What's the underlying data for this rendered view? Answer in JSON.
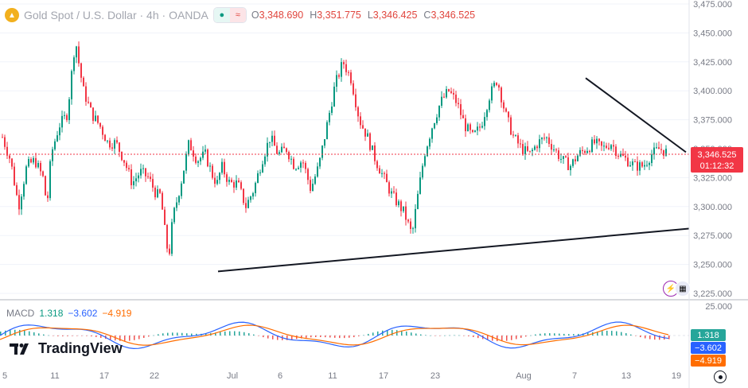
{
  "header": {
    "symbol_title": "Gold Spot / U.S. Dollar · 4h · OANDA",
    "pill_left_glyph": "●",
    "pill_right_glyph": "≈",
    "ohlc": [
      {
        "key": "O",
        "value": "3,348.690"
      },
      {
        "key": "H",
        "value": "3,351.775"
      },
      {
        "key": "L",
        "value": "3,346.425"
      },
      {
        "key": "C",
        "value": "3,346.525"
      }
    ]
  },
  "macd": {
    "name": "MACD",
    "v1": "1.318",
    "v2": "−3.602",
    "v3": "−4.919"
  },
  "branding": {
    "text": "TradingView"
  },
  "colors": {
    "up": "#089981",
    "down": "#f23645",
    "macd_line": "#2962ff",
    "signal_line": "#ff6d00",
    "price_label": "#f23645",
    "hist_up": "#26a69a",
    "hist_down": "#ef5350"
  },
  "chart_data": {
    "type": "candlestick",
    "price_axis": {
      "ticks": [
        "3,475.000",
        "3,450.000",
        "3,425.000",
        "3,400.000",
        "3,375.000",
        "3,350.000",
        "3,325.000",
        "3,300.000",
        "3,275.000",
        "3,250.000",
        "3,225.000"
      ],
      "range": [
        3225,
        3475
      ]
    },
    "last_price_label": "3,346.525",
    "countdown_label": "01:12:32",
    "last_price": 3346.525,
    "time_axis_labels": [
      "5",
      "11",
      "17",
      "22",
      "Jul",
      "6",
      "11",
      "17",
      "23",
      "Aug",
      "7",
      "13",
      "19"
    ],
    "close_path": [
      [
        0,
        3360
      ],
      [
        10,
        3340
      ],
      [
        20,
        3300
      ],
      [
        30,
        3335
      ],
      [
        40,
        3340
      ],
      [
        50,
        3325
      ],
      [
        55,
        3300
      ],
      [
        60,
        3345
      ],
      [
        70,
        3370
      ],
      [
        80,
        3380
      ],
      [
        90,
        3445
      ],
      [
        95,
        3420
      ],
      [
        100,
        3400
      ],
      [
        110,
        3380
      ],
      [
        120,
        3370
      ],
      [
        130,
        3355
      ],
      [
        140,
        3355
      ],
      [
        150,
        3340
      ],
      [
        160,
        3320
      ],
      [
        170,
        3330
      ],
      [
        180,
        3325
      ],
      [
        190,
        3310
      ],
      [
        195,
        3310
      ],
      [
        200,
        3280
      ],
      [
        205,
        3255
      ],
      [
        210,
        3290
      ],
      [
        220,
        3320
      ],
      [
        230,
        3355
      ],
      [
        240,
        3340
      ],
      [
        250,
        3345
      ],
      [
        260,
        3325
      ],
      [
        265,
        3320
      ],
      [
        270,
        3335
      ],
      [
        280,
        3320
      ],
      [
        290,
        3320
      ],
      [
        300,
        3300
      ],
      [
        310,
        3315
      ],
      [
        320,
        3340
      ],
      [
        330,
        3360
      ],
      [
        340,
        3345
      ],
      [
        350,
        3350
      ],
      [
        360,
        3335
      ],
      [
        370,
        3340
      ],
      [
        380,
        3315
      ],
      [
        390,
        3335
      ],
      [
        400,
        3370
      ],
      [
        410,
        3405
      ],
      [
        420,
        3425
      ],
      [
        430,
        3410
      ],
      [
        440,
        3375
      ],
      [
        450,
        3360
      ],
      [
        460,
        3340
      ],
      [
        470,
        3325
      ],
      [
        480,
        3310
      ],
      [
        490,
        3300
      ],
      [
        495,
        3295
      ],
      [
        500,
        3285
      ],
      [
        505,
        3275
      ],
      [
        510,
        3300
      ],
      [
        520,
        3345
      ],
      [
        530,
        3370
      ],
      [
        540,
        3390
      ],
      [
        550,
        3400
      ],
      [
        560,
        3390
      ],
      [
        570,
        3370
      ],
      [
        580,
        3360
      ],
      [
        590,
        3370
      ],
      [
        600,
        3395
      ],
      [
        610,
        3410
      ],
      [
        620,
        3380
      ],
      [
        630,
        3360
      ],
      [
        640,
        3350
      ],
      [
        650,
        3345
      ],
      [
        660,
        3355
      ],
      [
        670,
        3360
      ],
      [
        680,
        3350
      ],
      [
        690,
        3340
      ],
      [
        700,
        3335
      ],
      [
        710,
        3345
      ],
      [
        720,
        3350
      ],
      [
        730,
        3355
      ],
      [
        740,
        3350
      ],
      [
        750,
        3355
      ],
      [
        760,
        3345
      ],
      [
        770,
        3340
      ],
      [
        780,
        3335
      ],
      [
        790,
        3335
      ],
      [
        800,
        3345
      ],
      [
        810,
        3350
      ],
      [
        820,
        3346.5
      ]
    ],
    "macd_series": {
      "names": [
        "MACD",
        "Signal"
      ],
      "axis_ticks": [
        "25.000"
      ],
      "macd_value": 1.318,
      "signal_value": -3.602,
      "histogram_value": -4.919
    },
    "trendlines": [
      {
        "name": "support",
        "from": [
          3244,
          0.27
        ],
        "to": [
          3281,
          0.92
        ]
      },
      {
        "name": "resistance",
        "from": [
          3411,
          0.72
        ],
        "to": [
          3347,
          0.92
        ]
      }
    ]
  }
}
